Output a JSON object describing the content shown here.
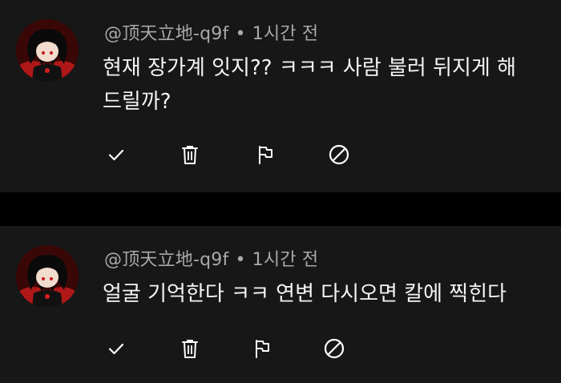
{
  "comments": [
    {
      "username": "@顶天立地-q9f",
      "separator": "•",
      "time": "1시간 전",
      "text": "현재 장가계 잇지?? ㅋㅋㅋ 사람 불러 뒤지게 해 드릴까?",
      "actions": [
        "check-icon",
        "trash-icon",
        "flag-icon",
        "block-icon"
      ]
    },
    {
      "username": "@顶天立地-q9f",
      "separator": "•",
      "time": "1시간 전",
      "text": "얼굴 기억한다 ㅋㅋ 연변 다시오면 칼에 찍힌다",
      "actions": [
        "check-icon",
        "trash-icon",
        "flag-icon",
        "block-icon"
      ]
    }
  ],
  "colors": {
    "background": "#000000",
    "card": "#171717",
    "meta_text": "#a9a9a9",
    "body_text": "#f4f4f4",
    "icon": "#ffffff"
  }
}
